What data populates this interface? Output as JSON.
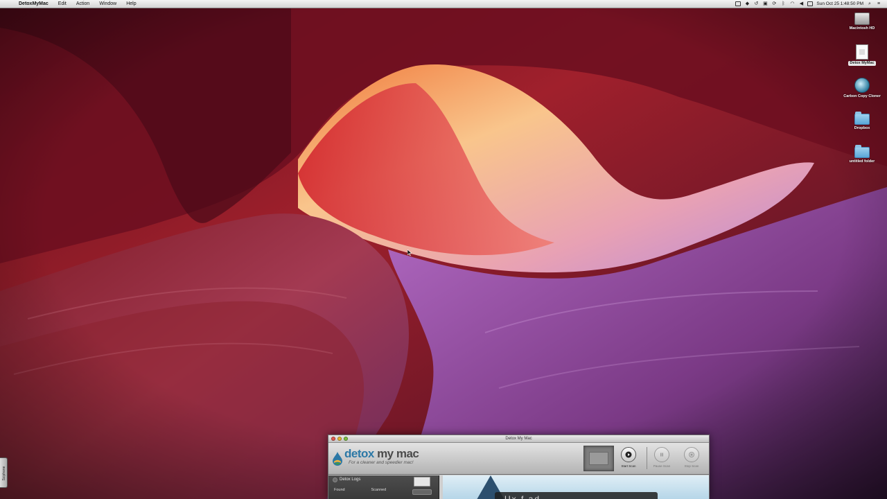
{
  "menubar": {
    "apple_symbol": "",
    "app_name": "DetoxMyMac",
    "items": [
      "Edit",
      "Action",
      "Window",
      "Help"
    ],
    "clock": "Sun Oct 25  1:48:50 PM"
  },
  "desktop": {
    "icons": [
      {
        "label": "Macintosh HD",
        "icon": "hard-drive-icon"
      },
      {
        "label": "Detox MyMac",
        "icon": "document-icon"
      },
      {
        "label": "Carbon Copy Cloner",
        "icon": "carbon-copy-cloner-icon"
      },
      {
        "label": "Dropbox",
        "icon": "folder-icon"
      },
      {
        "label": "untitled folder",
        "icon": "folder-icon"
      }
    ],
    "side_tab_label": "Sciphone"
  },
  "window": {
    "title": "Detox My Mac",
    "logo": {
      "detox": "detox",
      "my_mac": " my mac",
      "tagline": "For a cleaner and speedier mac!"
    },
    "toolbar": {
      "start_scan": "Start Scan",
      "pause_scan": "Pause Scan",
      "stop_scan": "Stop Scan"
    },
    "sidebar": {
      "detox_logs": "Detox Logs",
      "found": "Found",
      "scanned": "Scanned"
    },
    "main": {
      "overlay_text": "Ux    f    ad"
    }
  },
  "colors": {
    "brand_blue": "#2b78a6",
    "menubar_bg": "#e6e6e6",
    "sidebar_bg": "#444444"
  }
}
